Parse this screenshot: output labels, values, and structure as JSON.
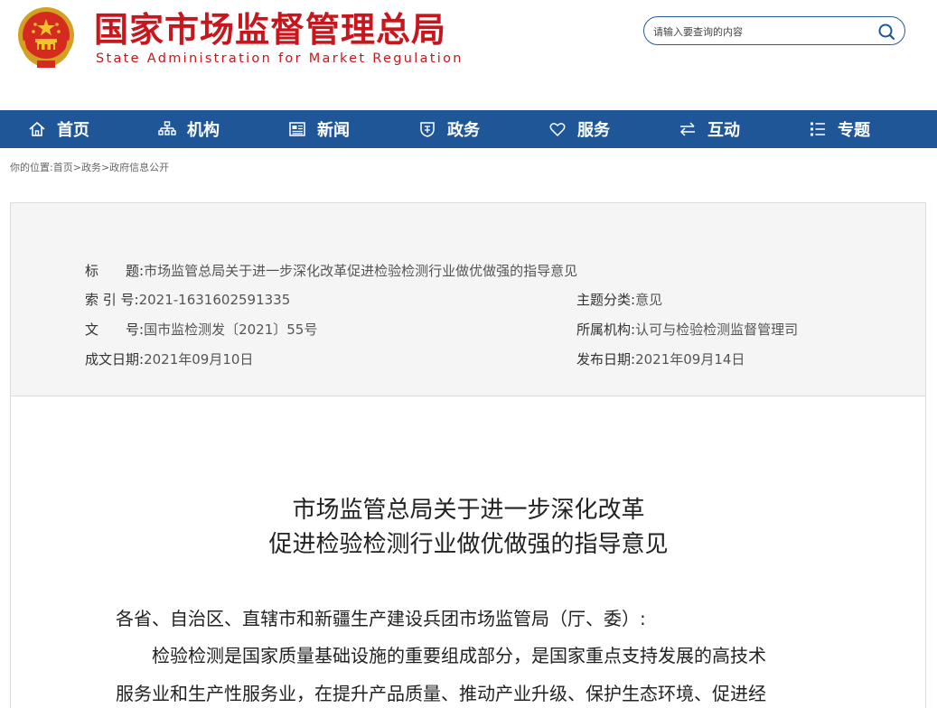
{
  "header": {
    "site_name_cn": "国家市场监督管理总局",
    "site_name_en": "State Administration for Market Regulation",
    "search_placeholder": "请输入要查询的内容"
  },
  "nav": {
    "items": [
      {
        "label": "首页",
        "icon": "home-icon"
      },
      {
        "label": "机构",
        "icon": "org-chart-icon"
      },
      {
        "label": "新闻",
        "icon": "news-icon"
      },
      {
        "label": "政务",
        "icon": "shield-icon"
      },
      {
        "label": "服务",
        "icon": "heart-icon"
      },
      {
        "label": "互动",
        "icon": "exchange-icon"
      },
      {
        "label": "专题",
        "icon": "topic-grid-icon"
      }
    ]
  },
  "breadcrumb": {
    "prefix": "你的位置:",
    "items": [
      "首页",
      "政务",
      "政府信息公开"
    ],
    "separator": ">"
  },
  "meta": {
    "title_label": "标　　题:",
    "title_value": "市场监管总局关于进一步深化改革促进检验检测行业做优做强的指导意见",
    "index_label": "索 引 号:",
    "index_value": "2021-1631602591335",
    "category_label": "主题分类:",
    "category_value": "意见",
    "docno_label": "文　　号:",
    "docno_value": "国市监检测发〔2021〕55号",
    "org_label": "所属机构:",
    "org_value": "认可与检验检测监督管理司",
    "created_label": "成文日期:",
    "created_value": "2021年09月10日",
    "published_label": "发布日期:",
    "published_value": "2021年09月14日"
  },
  "document": {
    "title_line1": "市场监管总局关于进一步深化改革",
    "title_line2": "促进检验检测行业做优做强的指导意见",
    "salutation": "各省、自治区、直辖市和新疆生产建设兵团市场监管局（厅、委）:",
    "para1_line1": "　　检验检测是国家质量基础设施的重要组成部分，是国家重点支持发展的高技术",
    "para1_line2": "服务业和生产性服务业，在提升产品质量、推动产业升级、保护生态环境、促进经"
  },
  "colors": {
    "brand_red": "#c8161d",
    "nav_blue": "#1e5698"
  }
}
